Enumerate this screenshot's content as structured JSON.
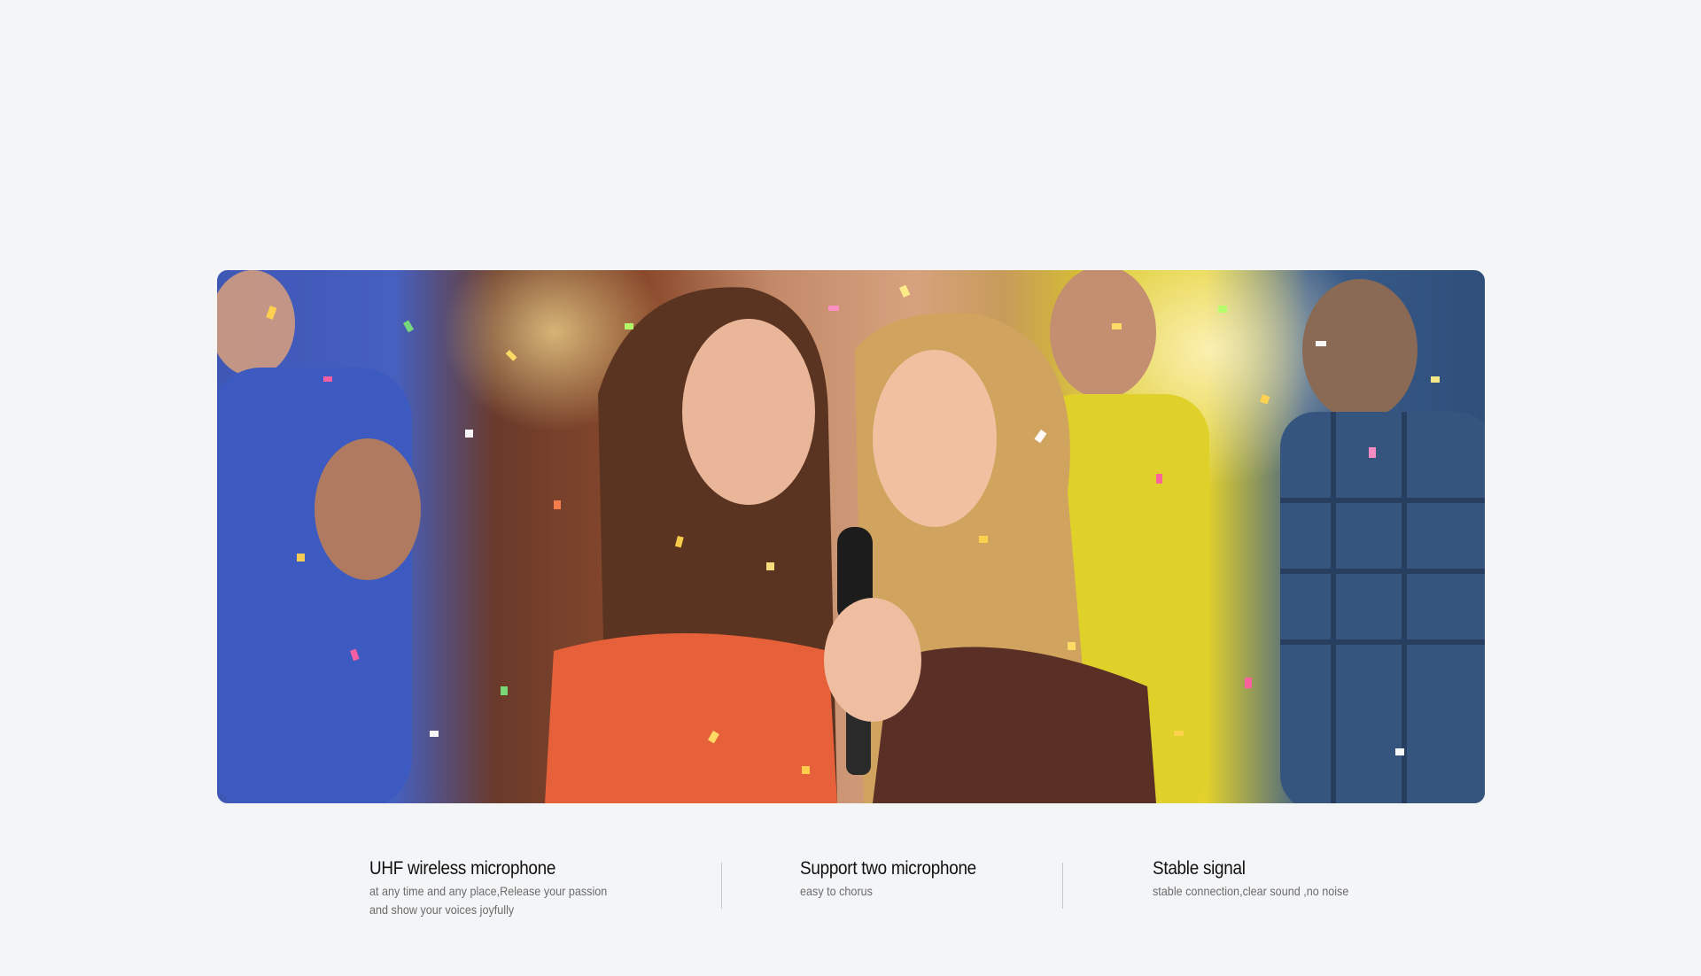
{
  "hero": {
    "image": "party-karaoke-photo",
    "subject": "two women singing into a black microphone with friends and falling confetti"
  },
  "features": [
    {
      "title": "UHF wireless microphone",
      "desc_line1": "at any time and any place,Release your passion",
      "desc_line2": "and show your voices joyfully"
    },
    {
      "title": "Support two microphone",
      "desc_line1": "easy to chorus"
    },
    {
      "title": "Stable signal",
      "desc_line1": "stable connection,clear sound ,no noise"
    }
  ]
}
